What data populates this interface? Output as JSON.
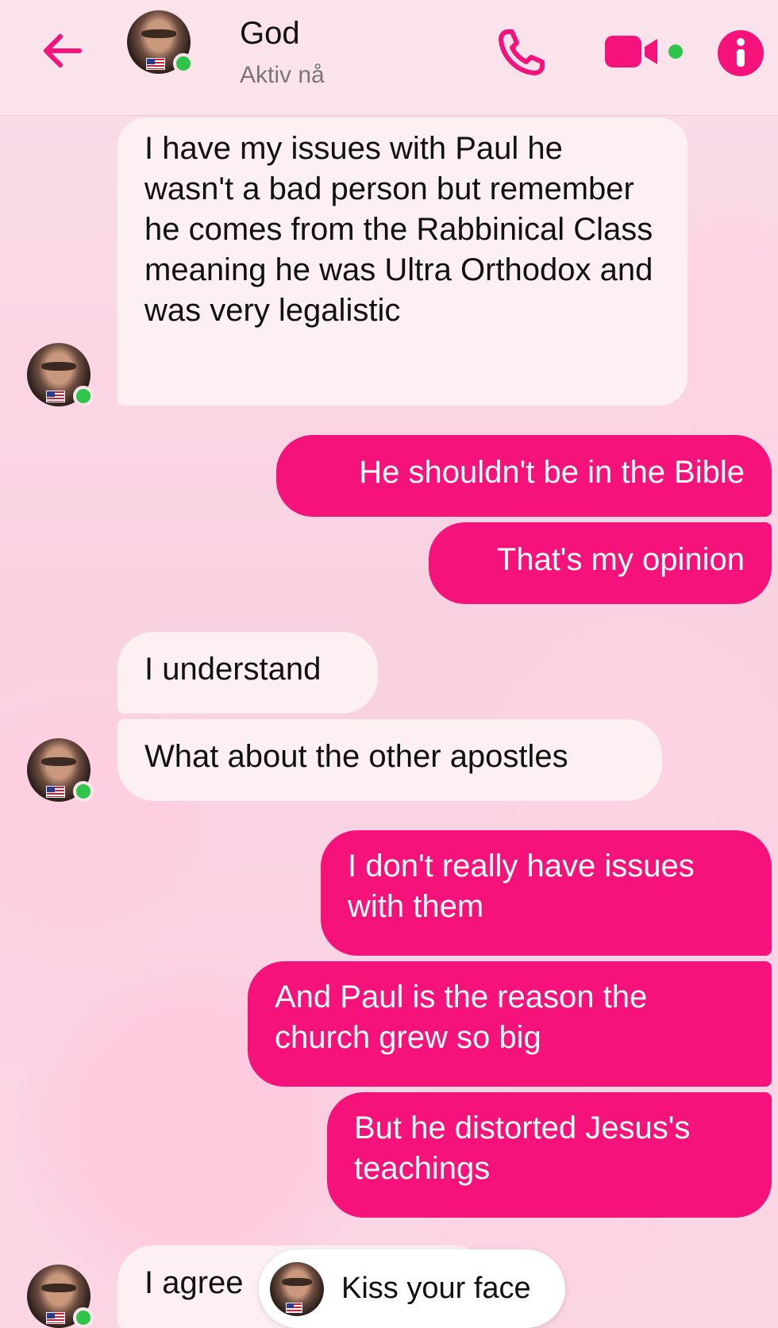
{
  "header": {
    "title": "God",
    "status": "Aktiv nå",
    "accent": "#f5127a",
    "online_color": "#2fc54a"
  },
  "messages": [
    {
      "side": "in",
      "text": "I have my issues with Paul he wasn't a bad person but remember he comes from the Rabbinical Class meaning he was Ultra Orthodox and was very legalistic"
    },
    {
      "side": "out",
      "text": "He shouldn't be in the Bible"
    },
    {
      "side": "out",
      "text": "That's my opinion"
    },
    {
      "side": "in",
      "text": "I understand"
    },
    {
      "side": "in",
      "text": "What about the other apostles"
    },
    {
      "side": "out",
      "text": "I don't really have issues with them"
    },
    {
      "side": "out",
      "text": "And Paul is the reason the church grew so big"
    },
    {
      "side": "out",
      "text": "But he distorted Jesus's teachings"
    },
    {
      "side": "in",
      "text": "I agree"
    }
  ],
  "popup": {
    "text": "Kiss your face"
  },
  "icons": [
    "back-arrow-icon",
    "phone-icon",
    "video-camera-icon",
    "info-icon"
  ]
}
